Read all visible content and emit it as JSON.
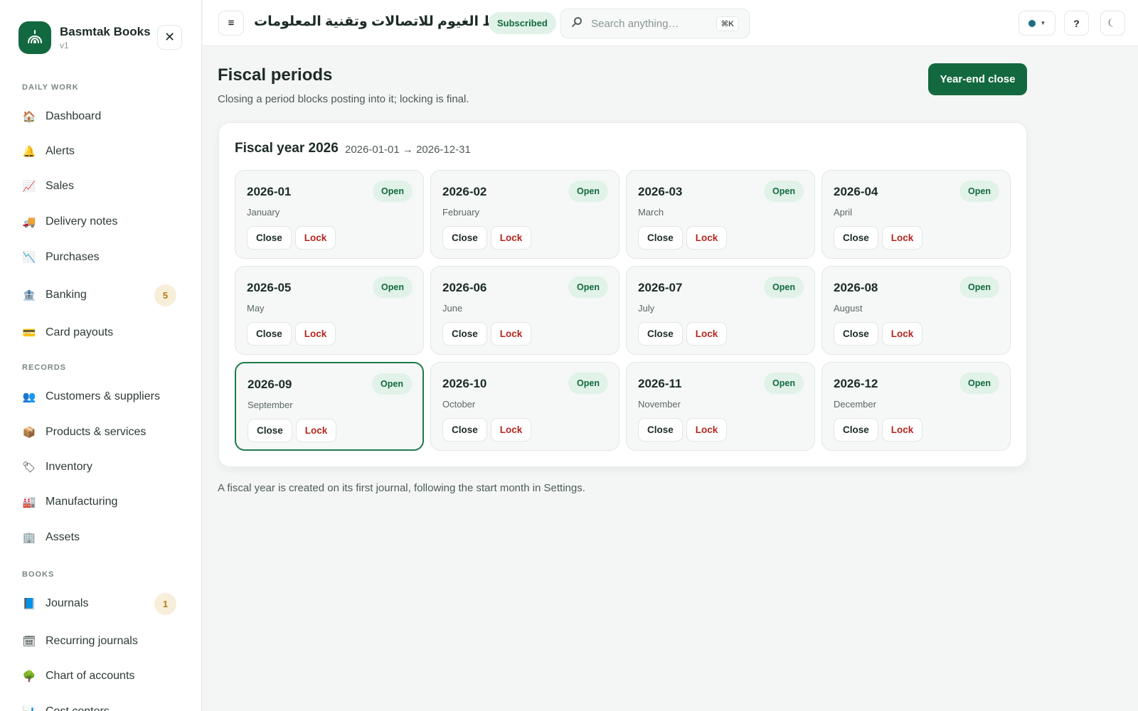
{
  "brand": {
    "name": "Basmtak Books",
    "version": "v1"
  },
  "sidebar": {
    "close_label": "✕",
    "sections": [
      {
        "label": "DAILY WORK",
        "items": [
          {
            "label": "Dashboard",
            "icon": "🏠",
            "icon_name": "home-icon"
          },
          {
            "label": "Alerts",
            "icon": "🔔",
            "icon_name": "bell-icon"
          },
          {
            "label": "Sales",
            "icon": "📈",
            "icon_name": "chart-up-icon"
          },
          {
            "label": "Delivery notes",
            "icon": "🚚",
            "icon_name": "truck-icon"
          },
          {
            "label": "Purchases",
            "icon": "📉",
            "icon_name": "chart-down-icon"
          },
          {
            "label": "Banking",
            "icon": "🏦",
            "icon_name": "bank-icon",
            "badge": "5"
          },
          {
            "label": "Card payouts",
            "icon": "💳",
            "icon_name": "card-icon"
          }
        ]
      },
      {
        "label": "RECORDS",
        "items": [
          {
            "label": "Customers & suppliers",
            "icon": "👥",
            "icon_name": "people-icon"
          },
          {
            "label": "Products & services",
            "icon": "📦",
            "icon_name": "package-icon"
          },
          {
            "label": "Inventory",
            "icon": "🏷",
            "icon_name": "tag-icon"
          },
          {
            "label": "Manufacturing",
            "icon": "🏭",
            "icon_name": "factory-icon"
          },
          {
            "label": "Assets",
            "icon": "🏢",
            "icon_name": "building-icon"
          }
        ]
      },
      {
        "label": "BOOKS",
        "items": [
          {
            "label": "Journals",
            "icon": "📘",
            "icon_name": "book-icon",
            "badge": "1"
          },
          {
            "label": "Recurring journals",
            "icon": "🗓",
            "icon_name": "calendar-icon"
          },
          {
            "label": "Chart of accounts",
            "icon": "🌳",
            "icon_name": "tree-icon"
          },
          {
            "label": "Cost centers",
            "icon": "📊",
            "icon_name": "bar-chart-icon"
          }
        ]
      }
    ]
  },
  "topbar": {
    "menu_label": "≡",
    "org_name": "خط الغيوم للاتصالات وتقنية المعلومات",
    "subscription": "Subscribed",
    "search_placeholder": "Search anything…",
    "search_value": "",
    "search_shortcut": "⌘K",
    "help_label": "?",
    "status_color": "#1e6b84"
  },
  "page": {
    "title": "Fiscal periods",
    "subtitle": "Closing a period blocks posting into it; locking is final.",
    "year_end_label": "Year-end close",
    "fiscal_year_title": "Fiscal year 2026",
    "fiscal_year_range": "2026-01-01 → 2026-12-31",
    "footnote": "A fiscal year is created on its first journal, following the start month in Settings."
  },
  "periods": [
    {
      "code": "2026-01",
      "month": "January",
      "status": "Open",
      "close": "Close",
      "lock": "Lock"
    },
    {
      "code": "2026-02",
      "month": "February",
      "status": "Open",
      "close": "Close",
      "lock": "Lock"
    },
    {
      "code": "2026-03",
      "month": "March",
      "status": "Open",
      "close": "Close",
      "lock": "Lock"
    },
    {
      "code": "2026-04",
      "month": "April",
      "status": "Open",
      "close": "Close",
      "lock": "Lock"
    },
    {
      "code": "2026-05",
      "month": "May",
      "status": "Open",
      "close": "Close",
      "lock": "Lock"
    },
    {
      "code": "2026-06",
      "month": "June",
      "status": "Open",
      "close": "Close",
      "lock": "Lock"
    },
    {
      "code": "2026-07",
      "month": "July",
      "status": "Open",
      "close": "Close",
      "lock": "Lock"
    },
    {
      "code": "2026-08",
      "month": "August",
      "status": "Open",
      "close": "Close",
      "lock": "Lock"
    },
    {
      "code": "2026-09",
      "month": "September",
      "status": "Open",
      "close": "Close",
      "lock": "Lock",
      "active": true
    },
    {
      "code": "2026-10",
      "month": "October",
      "status": "Open",
      "close": "Close",
      "lock": "Lock"
    },
    {
      "code": "2026-11",
      "month": "November",
      "status": "Open",
      "close": "Close",
      "lock": "Lock"
    },
    {
      "code": "2026-12",
      "month": "December",
      "status": "Open",
      "close": "Close",
      "lock": "Lock"
    }
  ],
  "colors": {
    "brand": "#13693f",
    "danger": "#b3261e",
    "badge": "#b8781d"
  }
}
